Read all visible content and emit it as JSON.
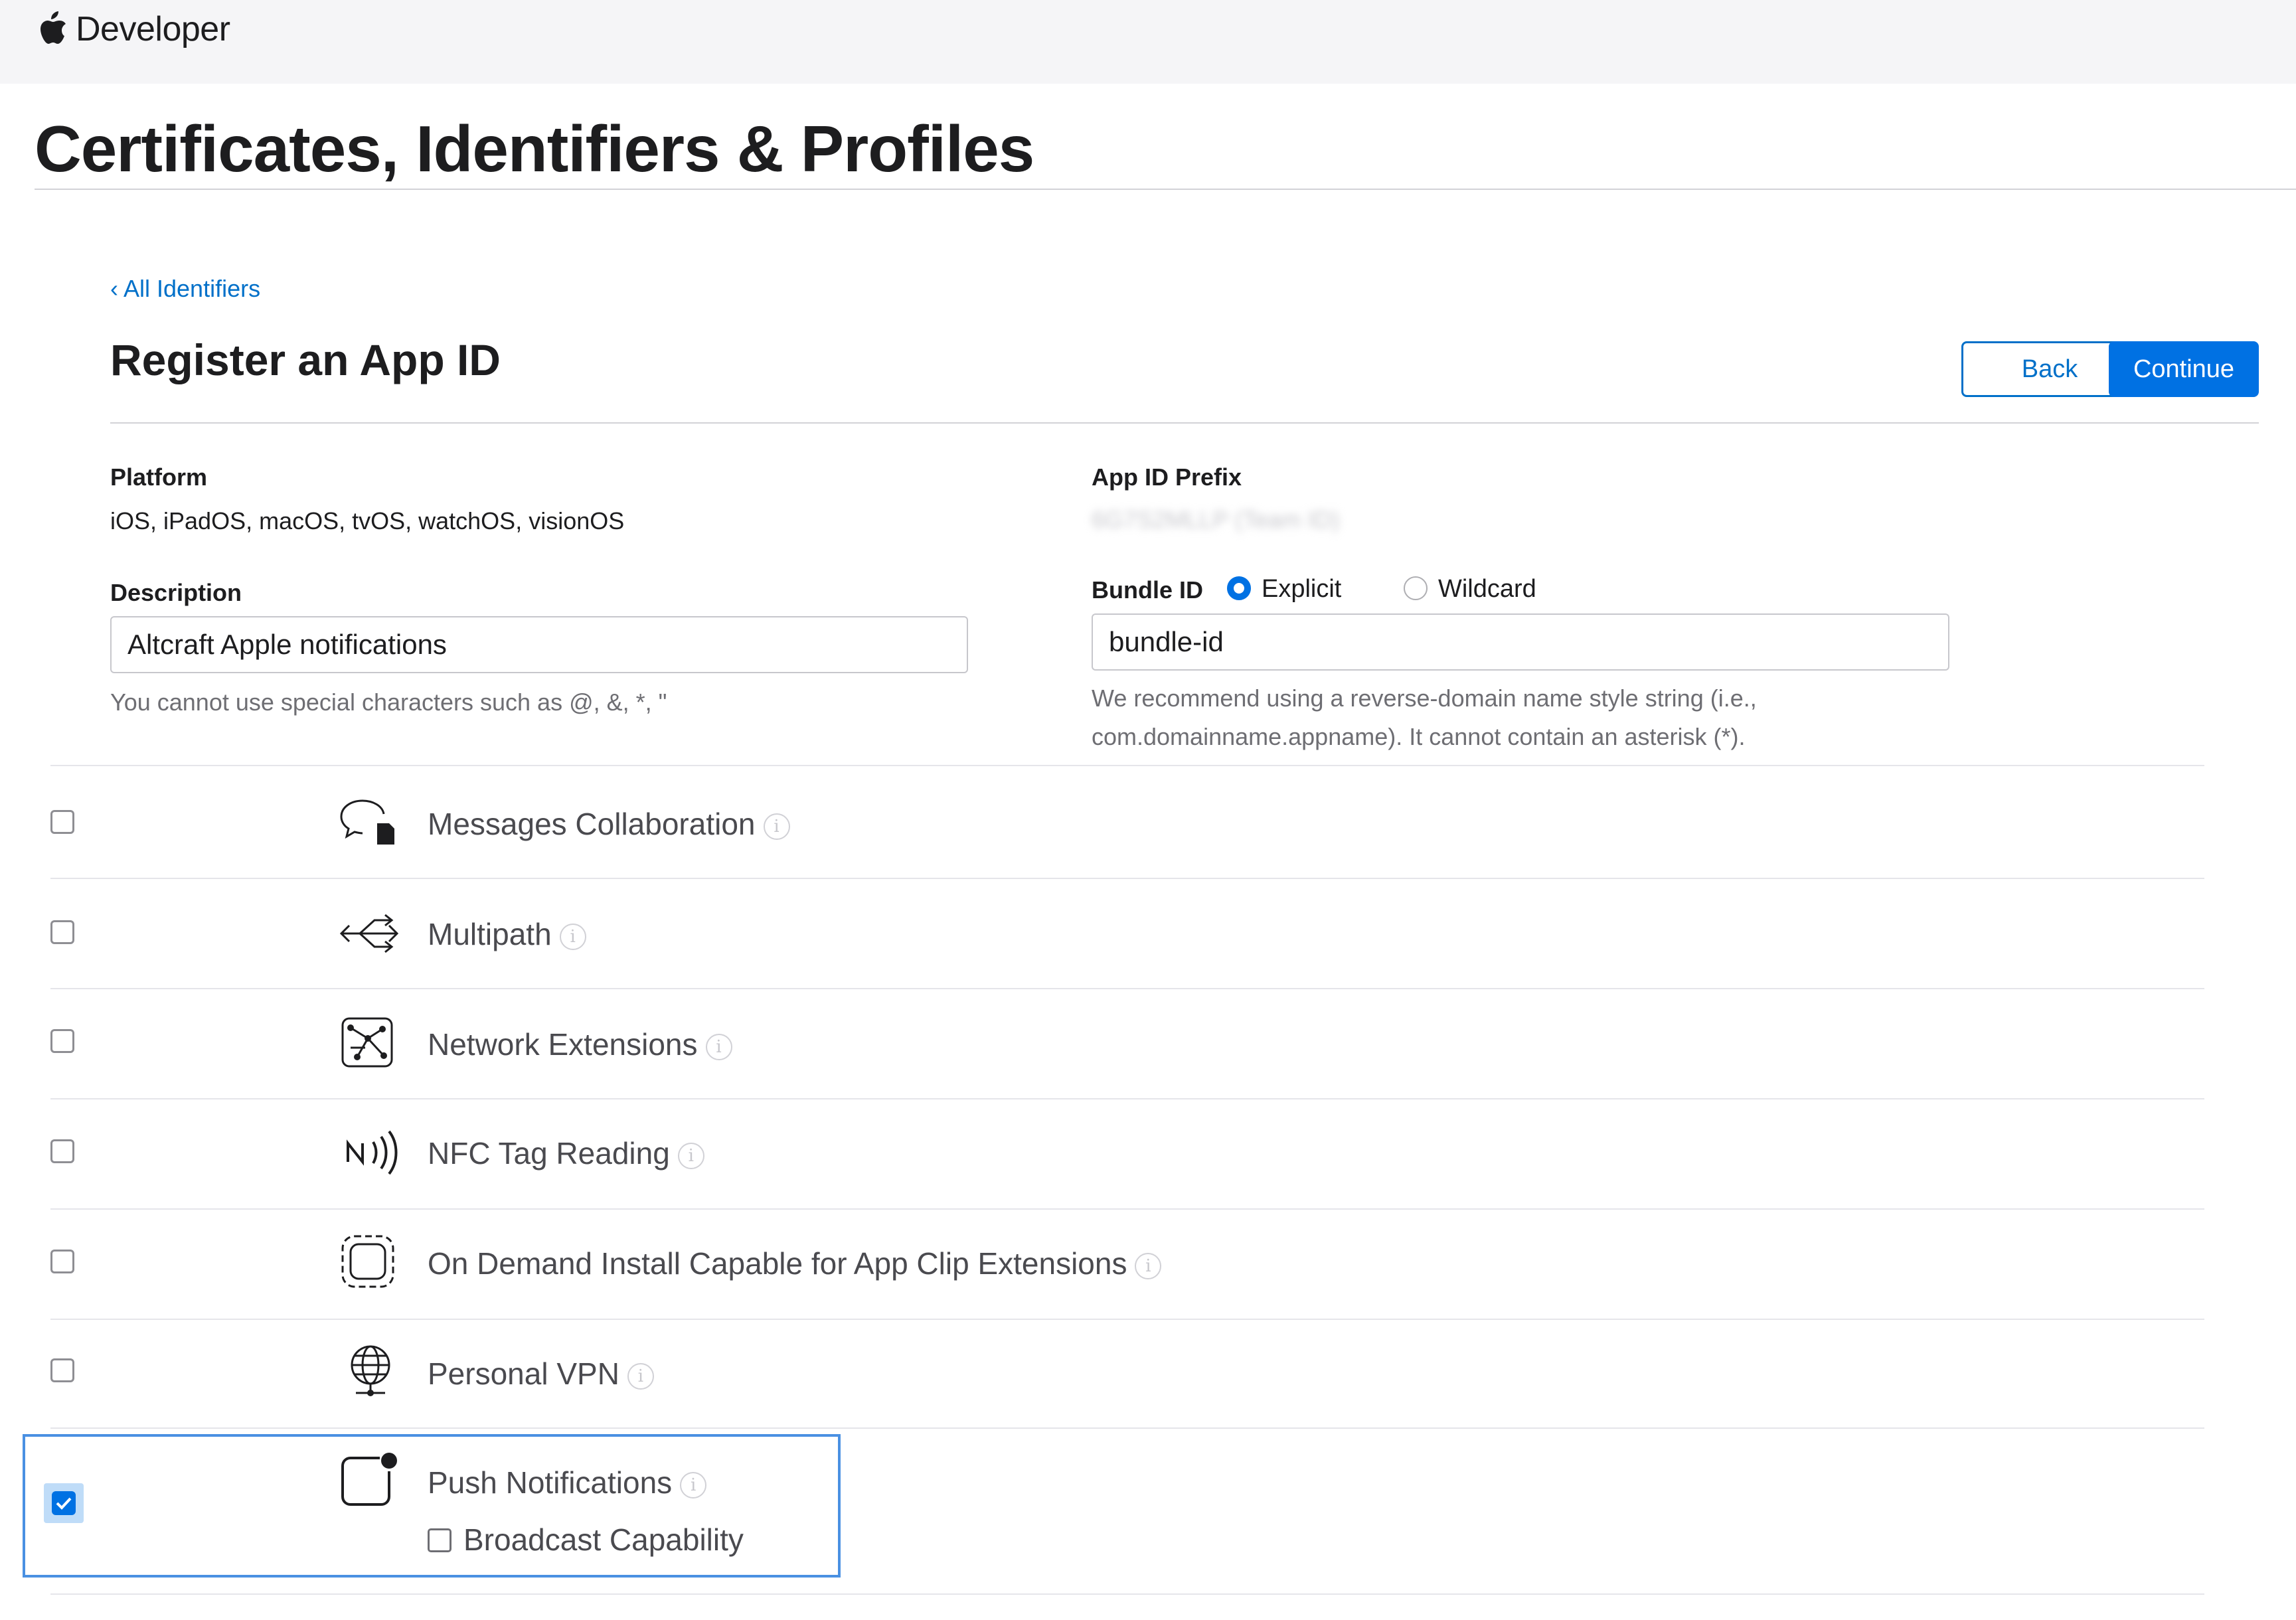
{
  "header": {
    "brand": "Developer",
    "logo": "apple-icon"
  },
  "page_title": "Certificates, Identifiers & Profiles",
  "breadcrumb": "‹ All Identifiers",
  "section_title": "Register an App ID",
  "buttons": {
    "back": "Back",
    "continue": "Continue"
  },
  "platform": {
    "label": "Platform",
    "value": "iOS, iPadOS, macOS, tvOS, watchOS, visionOS"
  },
  "app_id_prefix": {
    "label": "App ID Prefix",
    "value": "6G7S2MLLP (Team ID)"
  },
  "description": {
    "label": "Description",
    "value": "Altcraft Apple notifications",
    "hint": "You cannot use special characters such as @, &, *, \""
  },
  "bundle_id": {
    "label": "Bundle ID",
    "options": [
      {
        "label": "Explicit",
        "selected": true
      },
      {
        "label": "Wildcard",
        "selected": false
      }
    ],
    "value": "bundle-id",
    "hint_line1": "We recommend using a reverse-domain name style string (i.e.,",
    "hint_line2": "com.domainname.appname). It cannot contain an asterisk (*)."
  },
  "capabilities": [
    {
      "label": "Messages Collaboration",
      "icon": "messages-collaboration-icon",
      "checked": false
    },
    {
      "label": "Multipath",
      "icon": "multipath-icon",
      "checked": false
    },
    {
      "label": "Network Extensions",
      "icon": "network-extensions-icon",
      "checked": false
    },
    {
      "label": "NFC Tag Reading",
      "icon": "nfc-icon",
      "checked": false
    },
    {
      "label": "On Demand Install Capable for App Clip Extensions",
      "icon": "app-clip-icon",
      "checked": false
    },
    {
      "label": "Personal VPN",
      "icon": "vpn-globe-icon",
      "checked": false
    },
    {
      "label": "Push Notifications",
      "icon": "push-notifications-icon",
      "checked": true,
      "sub_option": {
        "label": "Broadcast Capability",
        "checked": false
      }
    }
  ],
  "colors": {
    "accent": "#0071e3",
    "link": "#0070c9",
    "highlight": "#4a90e2"
  }
}
